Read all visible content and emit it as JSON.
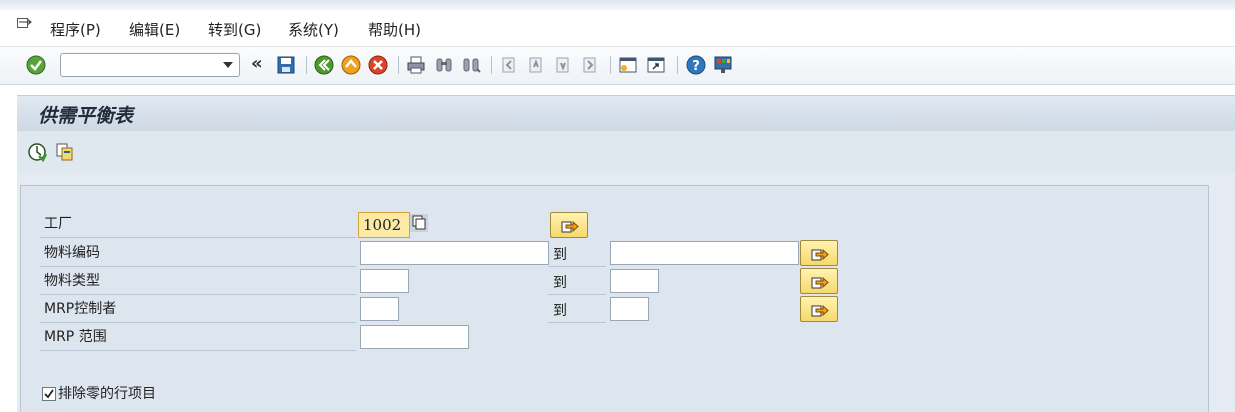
{
  "menubar": {
    "items": [
      {
        "label": "程序(P)"
      },
      {
        "label": "编辑(E)"
      },
      {
        "label": "转到(G)"
      },
      {
        "label": "系统(Y)"
      },
      {
        "label": "帮助(H)"
      }
    ]
  },
  "toolbar": {
    "command_value": "",
    "back_glyph": "«"
  },
  "title": "供需平衡表",
  "form": {
    "plant": {
      "label": "工厂",
      "value": "1002"
    },
    "material": {
      "label": "物料编码",
      "from": "",
      "to_label": "到",
      "to": ""
    },
    "material_type": {
      "label": "物料类型",
      "from": "",
      "to_label": "到",
      "to": ""
    },
    "mrp_controller": {
      "label": "MRP控制者",
      "from": "",
      "to_label": "到",
      "to": ""
    },
    "mrp_area": {
      "label": "MRP 范围",
      "value": ""
    },
    "exclude_zero": {
      "label": "排除零的行项目",
      "checked": true
    }
  },
  "colors": {
    "accent": "#f6d86b",
    "title_bg": "#cdd8e4",
    "content_bg": "#dde6ef"
  }
}
